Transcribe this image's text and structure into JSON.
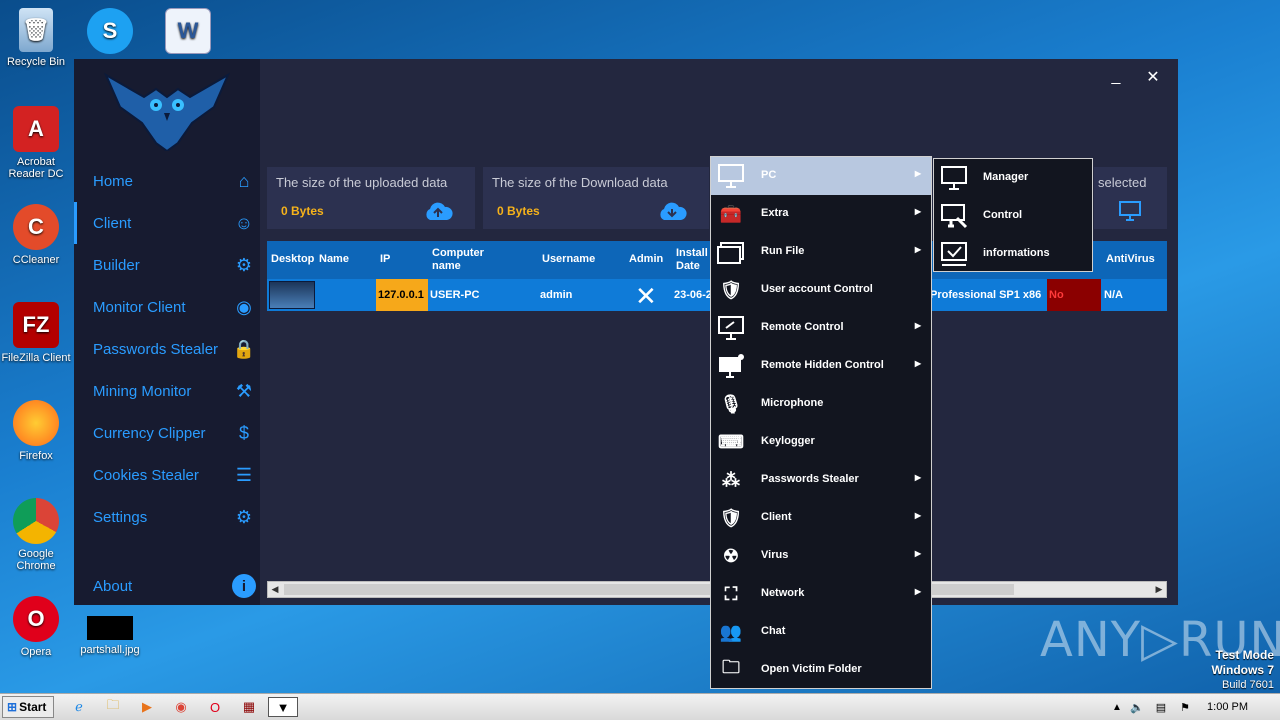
{
  "desktop": {
    "icons": [
      {
        "label": "Recycle Bin"
      },
      {
        "label": ""
      },
      {
        "label": ""
      },
      {
        "label": "Acrobat Reader DC"
      },
      {
        "label": "CCleaner"
      },
      {
        "label": "FileZilla Client"
      },
      {
        "label": "Firefox"
      },
      {
        "label": "Google Chrome"
      },
      {
        "label": "Opera"
      },
      {
        "label": "partshall.jpg"
      }
    ],
    "watermark": "ANY▷RUN",
    "test_mode": {
      "line1": "Test Mode",
      "line2": "Windows 7",
      "line3": "Build 7601"
    }
  },
  "app": {
    "nav": [
      {
        "label": "Home",
        "icon": "home-icon"
      },
      {
        "label": "Client",
        "icon": "user-icon"
      },
      {
        "label": "Builder",
        "icon": "gear-icon"
      },
      {
        "label": "Monitor Client",
        "icon": "eye-icon"
      },
      {
        "label": "Passwords Stealer",
        "icon": "lock-icon"
      },
      {
        "label": "Mining Monitor",
        "icon": "pickaxe-icon"
      },
      {
        "label": "Currency Clipper",
        "icon": "coin-icon"
      },
      {
        "label": "Cookies Stealer",
        "icon": "list-icon"
      },
      {
        "label": "Settings",
        "icon": "user-gear-icon"
      },
      {
        "label": "About",
        "icon": "info-icon"
      }
    ],
    "cards": [
      {
        "title": "The size of the uploaded data",
        "value": "0 Bytes"
      },
      {
        "title": "The size of the Download data",
        "value": "0 Bytes"
      },
      {
        "title": "selected"
      }
    ],
    "grid": {
      "headers": {
        "desktop": "Desktop",
        "name": "Name",
        "ip": "IP",
        "computer1": "Computer",
        "computer2": "name",
        "username": "Username",
        "admin": "Admin",
        "install1": "Install",
        "install2": "Date",
        "antivirus": "AntiVirus"
      },
      "row": {
        "ip": "127.0.0.1",
        "computer": "USER-PC",
        "username": "admin",
        "install": "23-06-2",
        "os": "Professional SP1 x86",
        "flag": "No",
        "antivirus": "N/A"
      }
    }
  },
  "context_menu": {
    "items": [
      {
        "label": "PC",
        "icon": "monitor-icon",
        "arrow": true
      },
      {
        "label": "Extra",
        "icon": "toolbox-icon",
        "arrow": true
      },
      {
        "label": "Run File",
        "icon": "window-icon",
        "arrow": true
      },
      {
        "label": "User account Control",
        "icon": "shield-user-icon",
        "arrow": false
      },
      {
        "label": "Remote Control",
        "icon": "remote-desktop-icon",
        "arrow": true
      },
      {
        "label": "Remote Hidden Control",
        "icon": "hidden-desktop-icon",
        "arrow": true
      },
      {
        "label": "Microphone",
        "icon": "microphone-icon",
        "arrow": false
      },
      {
        "label": "Keylogger",
        "icon": "keyboard-icon",
        "arrow": false
      },
      {
        "label": "Passwords Stealer",
        "icon": "password-icon",
        "arrow": true
      },
      {
        "label": "Client",
        "icon": "shield-client-icon",
        "arrow": true
      },
      {
        "label": "Virus",
        "icon": "radiation-icon",
        "arrow": true
      },
      {
        "label": "Network",
        "icon": "network-icon",
        "arrow": true
      },
      {
        "label": "Chat",
        "icon": "chat-icon",
        "arrow": false
      },
      {
        "label": "Open Victim Folder",
        "icon": "folder-search-icon",
        "arrow": false
      }
    ],
    "submenu": [
      {
        "label": "Manager",
        "icon": "monitor-icon"
      },
      {
        "label": "Control",
        "icon": "monitor-wrench-icon"
      },
      {
        "label": "informations",
        "icon": "checkbox-icon"
      }
    ]
  },
  "taskbar": {
    "start": "Start",
    "clock": "1:00 PM"
  },
  "colors": {
    "accent": "#2a9cff",
    "sidebar": "#171b30",
    "panel": "#23273f",
    "grid_header": "#0d66b8",
    "grid_row": "#0f7bd8",
    "ip_cell": "#f6a81a",
    "flag_cell": "#8b0000"
  }
}
